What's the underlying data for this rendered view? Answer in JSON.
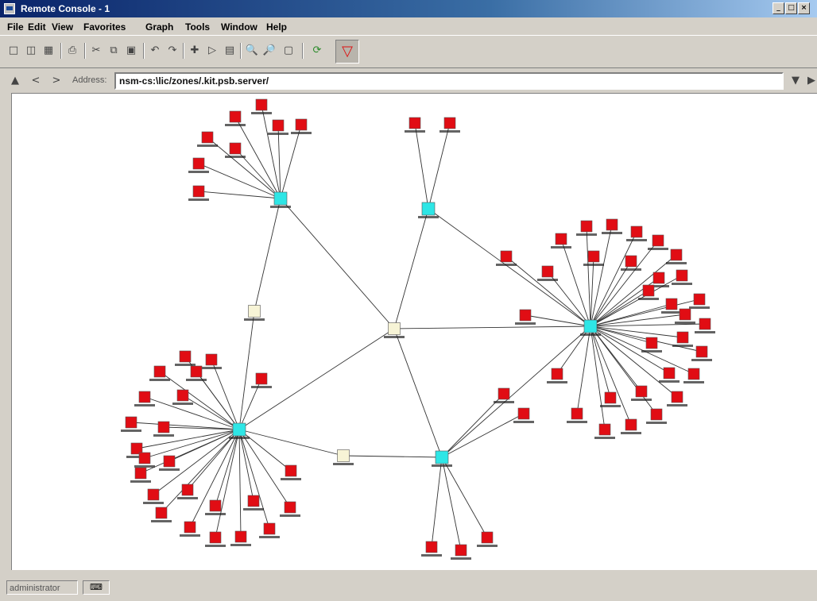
{
  "window": {
    "title": "Remote Console - 1"
  },
  "menu": [
    "File",
    "Edit",
    "View",
    "Favorites",
    "Graph",
    "Tools",
    "Window",
    "Help"
  ],
  "address": {
    "label": "Address:",
    "value": "nsm-cs:\\lic/zones/.kit.psb.server/"
  },
  "status": {
    "user": "administrator"
  },
  "colors": {
    "host": "#e10d14",
    "hub": "#2ee6e6",
    "router": "#f7f4d6",
    "edge": "#333333"
  },
  "toolbar_icons": [
    "new-icon",
    "open-icon",
    "print-preview-icon",
    "print-icon",
    "cut-icon",
    "copy-icon",
    "paste-icon",
    "undo-icon",
    "redo-icon",
    "add-node-icon",
    "expand-icon",
    "delete-icon",
    "zoom-in-icon",
    "zoom-out-icon",
    "fit-icon",
    "refresh-icon",
    "graph-view-icon"
  ]
}
